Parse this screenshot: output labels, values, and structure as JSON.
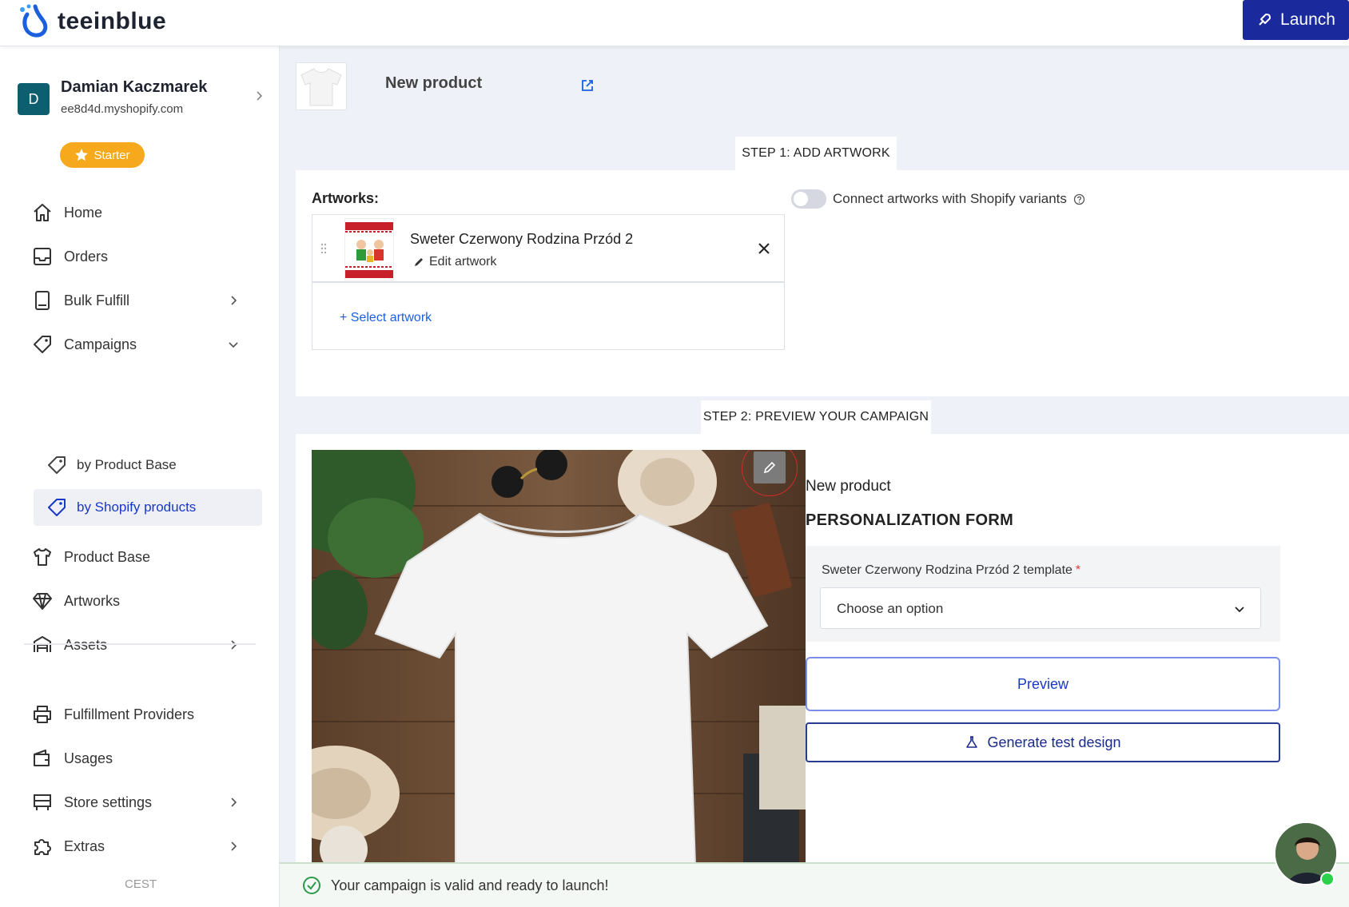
{
  "header": {
    "brand": "teeinblue",
    "launch_label": "Launch"
  },
  "user": {
    "initial": "D",
    "name": "Damian Kaczmarek",
    "domain": "ee8d4d.myshopify.com",
    "plan": "Starter"
  },
  "nav": {
    "home": "Home",
    "orders": "Orders",
    "bulk_fulfill": "Bulk Fulfill",
    "campaigns": "Campaigns",
    "by_product_base": "by Product Base",
    "by_shopify_products": "by Shopify products",
    "product_base": "Product Base",
    "artworks": "Artworks",
    "assets": "Assets",
    "fulfillment_providers": "Fulfillment Providers",
    "usages": "Usages",
    "store_settings": "Store settings",
    "extras": "Extras",
    "timezone": "CEST"
  },
  "product": {
    "title": "New product"
  },
  "step1": {
    "tab_label": "STEP 1: ADD ARTWORK",
    "artworks_label": "Artworks:",
    "artwork_name": "Sweter Czerwony Rodzina Przód 2",
    "edit_label": "Edit artwork",
    "select_label": "+ Select artwork",
    "connect_label": "Connect artworks with Shopify variants"
  },
  "step2": {
    "tab_label": "STEP 2: PREVIEW YOUR CAMPAIGN",
    "product_name": "New product",
    "form_title": "PERSONALIZATION FORM",
    "field_label": "Sweter Czerwony Rodzina Przód 2 template",
    "required_mark": "*",
    "select_placeholder": "Choose an option",
    "preview_label": "Preview",
    "generate_label": "Generate test design"
  },
  "status": {
    "message": "Your campaign is valid and ready to launch!"
  },
  "colors": {
    "accent": "#1a2a9c",
    "link": "#1a5fe0",
    "plan_badge": "#f6a91c",
    "success": "#2b9a4a"
  }
}
